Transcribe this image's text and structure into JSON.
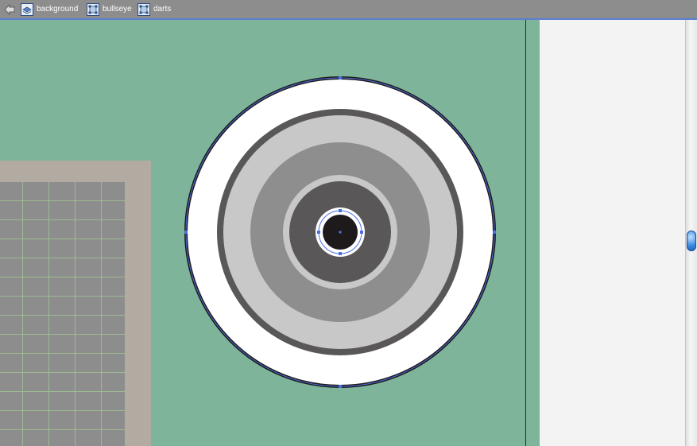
{
  "breadcrumb": {
    "back_icon": "back-arrow-icon",
    "items": [
      {
        "label": "background",
        "icon": "layer-icon"
      },
      {
        "label": "bullseye",
        "icon": "group-icon"
      },
      {
        "label": "darts",
        "icon": "group-icon"
      }
    ]
  },
  "colors": {
    "canvas": "#7db49a",
    "panel": "#f3f3f3",
    "grid_frame": "#b1aba2",
    "grid_fill": "#8d8d8d",
    "grid_lines": "#9dbb91",
    "selection": "#4c6fe0",
    "ring_white": "#ffffff",
    "ring_dark": "#595758",
    "ring_light": "#c8c8c8",
    "ring_mid": "#8e8e8e",
    "center": "#1e1a1b"
  }
}
